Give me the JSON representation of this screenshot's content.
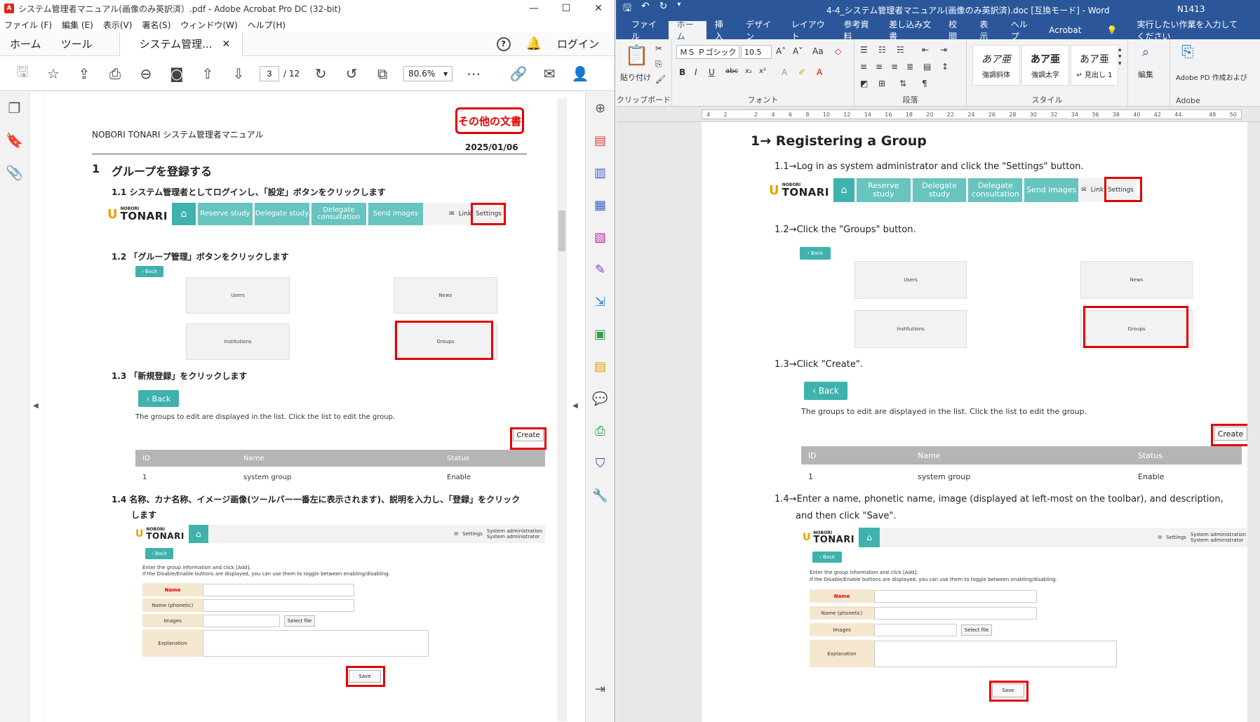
{
  "acrobat": {
    "title": "システム管理者マニュアル(画像のみ英訳済）.pdf - Adobe Acrobat Pro DC (32-bit)",
    "menu": [
      "ファイル (F)",
      "編集 (E)",
      "表示(V)",
      "署名(S)",
      "ウィンドウ(W)",
      "ヘルプ(H)"
    ],
    "tabs": {
      "home": "ホーム",
      "tools": "ツール",
      "doc": "システム管理..."
    },
    "help": "?",
    "login": "ログイン",
    "page_current": "3",
    "page_total": "/ 12",
    "zoom": "80.6%",
    "page": {
      "stamp": "その他の文書",
      "header": "NOBORI TONARI システム管理者マニュアル",
      "date": "2025/01/06",
      "h1_num": "1",
      "h1": "グループを登録する",
      "s11": "1.1 システム管理者としてログインし、「設定」ボタンをクリックします",
      "s12": "1.2 「グループ管理」ボタンをクリックします",
      "s13": "1.3 「新規登録」をクリックします",
      "s14a": "1.4 名称、カナ名称、イメージ画像(ツールバー一番左に表示されます)、説明を入力し、「登録」をクリック",
      "s14b": "します"
    }
  },
  "word": {
    "title": "4-4_システム管理者マニュアル(画像のみ英訳済).doc [互換モード] - Word",
    "user": "N1413",
    "tabs": [
      "ファイル",
      "ホーム",
      "挿入",
      "デザイン",
      "レイアウト",
      "参考資料",
      "差し込み文書",
      "校閲",
      "表示",
      "ヘルプ",
      "Acrobat",
      "実行したい作業を入力してください"
    ],
    "ribbon": {
      "paste": "貼り付け",
      "clipboard": "クリップボード",
      "font_name": "ＭＳ Ｐゴシック",
      "font_size": "10.5",
      "font": "フォント",
      "paragraph": "段落",
      "styles": "スタイル",
      "style1": "強調斜体",
      "style2": "強調太字",
      "style3": "↵ 見出し 1",
      "style_sample": "あア亜",
      "edit": "編集",
      "adobe": "Adobe PD 作成および",
      "adobe2": "Adobe"
    },
    "ruler": [
      "4",
      "2",
      "",
      "2",
      "4",
      "6",
      "8",
      "10",
      "12",
      "14",
      "16",
      "18",
      "20",
      "22",
      "24",
      "26",
      "28",
      "30",
      "32",
      "34",
      "36",
      "38",
      "40",
      "42",
      "44",
      "",
      "48",
      "50"
    ],
    "page": {
      "h1": "1→ Registering a Group",
      "s11": "1.1→Log in as system administrator and click the \"Settings\" button.",
      "s12": "1.2→Click the \"Groups\" button.",
      "s13": "1.3→Click \"Create\".",
      "s14a": "1.4→Enter a name, phonetic name, image (displayed at left-most on the toolbar), and description,",
      "s14b": "and then click \"Save\"."
    }
  },
  "app": {
    "logo_small": "NOBORI",
    "logo_big": "TONARI",
    "nav": [
      "Reserve study",
      "Delegate study",
      "Delegate consultation",
      "Send images"
    ],
    "link": "Link",
    "settings": "Settings",
    "sysadmin1": "System administration",
    "sysadmin2": "System administrator",
    "back": "‹ Back",
    "tiles": {
      "users": "Users",
      "news": "News",
      "institutions": "Institutions",
      "groups": "Groups"
    },
    "list_help": "The groups to edit are displayed in the list. Click the list to edit the group.",
    "create": "Create",
    "cols": [
      "ID",
      "Name",
      "Status"
    ],
    "row": [
      "1",
      "system group",
      "Enable"
    ],
    "form_help1": "Enter the group information and click [Add].",
    "form_help2": "If the Disable/Enable buttons are displayed, you can use them to toggle between enabling/disabling.",
    "f_name": "Name",
    "f_phonetic": "Name (phonetic)",
    "f_images": "Images",
    "f_select": "Select file",
    "f_expl": "Explanation",
    "save": "Save"
  },
  "colors": {
    "accent": "#3fb2ad",
    "nav": "#67c4bf",
    "highlight": "#e30000",
    "word": "#2b579a"
  }
}
